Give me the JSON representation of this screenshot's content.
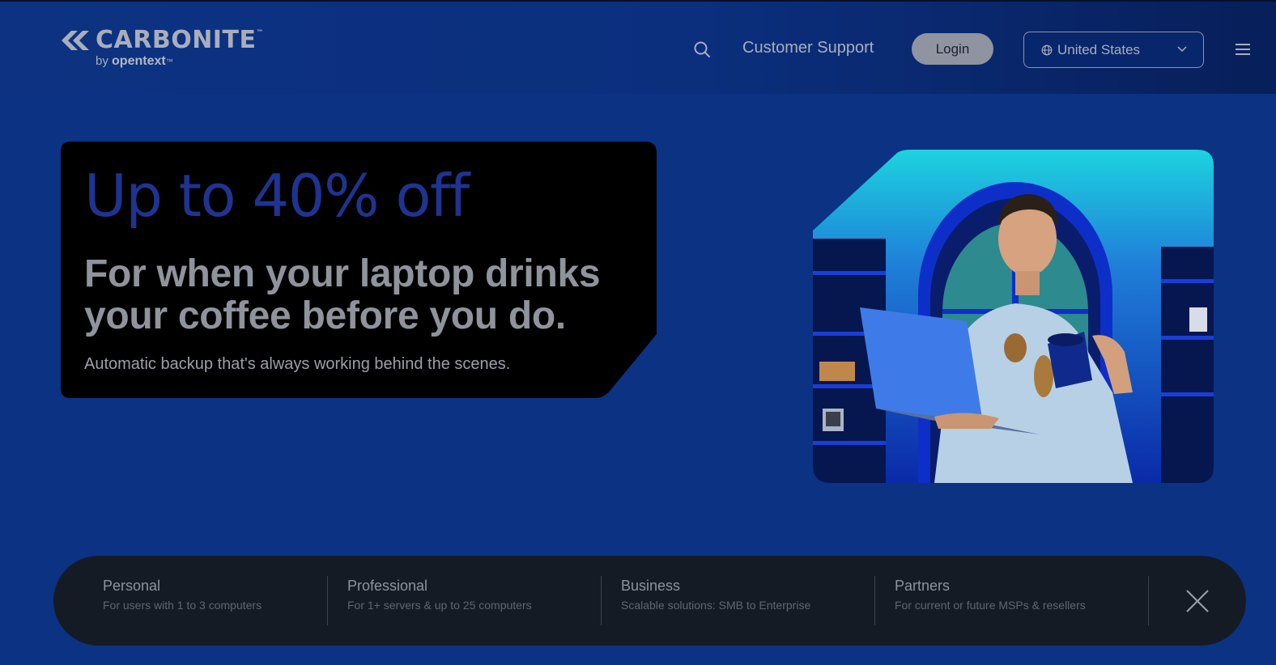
{
  "header": {
    "logo": {
      "wordmark": "CARBONITE",
      "trademark": "™",
      "by": "by",
      "parent_brand": "opentext",
      "parent_tm": "™"
    },
    "search_icon": "search-icon",
    "support_link": "Customer Support",
    "login_label": "Login",
    "region": {
      "selected": "United States",
      "icon": "globe-icon"
    },
    "menu_icon": "hamburger-menu-icon"
  },
  "hero": {
    "title": "Up to 40% off",
    "subtitle_line1": "For when your laptop drinks",
    "subtitle_line2": "your coffee before you do.",
    "description": "Automatic backup that's always working behind the scenes."
  },
  "segments": [
    {
      "title": "Personal",
      "subtitle": "For users with 1 to 3 computers"
    },
    {
      "title": "Professional",
      "subtitle": "For 1+ servers & up to 25 computers"
    },
    {
      "title": "Business",
      "subtitle": "Scalable solutions: SMB to Enterprise"
    },
    {
      "title": "Partners",
      "subtitle": "For current or future MSPs & resellers"
    }
  ],
  "colors": {
    "page_bg": "#0c3283",
    "hero_title": "#1f3391",
    "card_bg": "#000000",
    "segment_bar_bg": "#151b25"
  }
}
